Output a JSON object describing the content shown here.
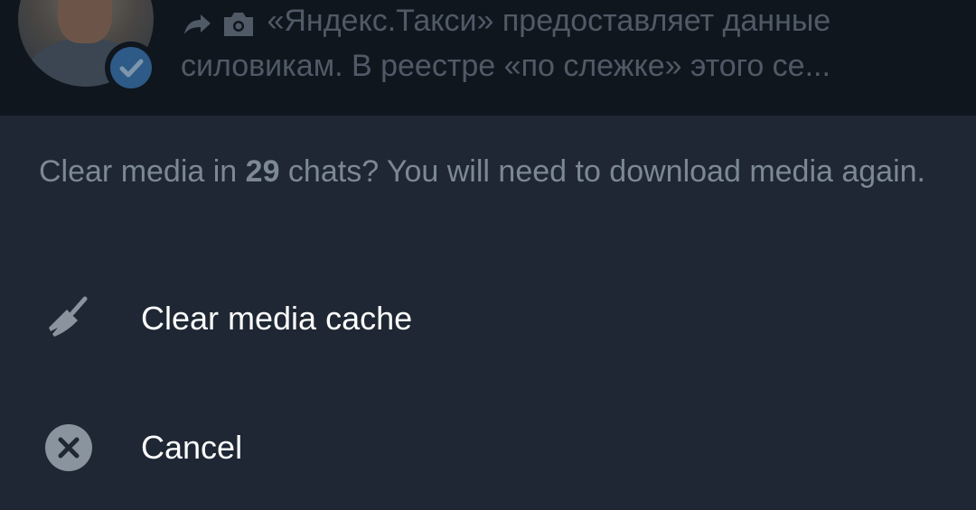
{
  "background_chat": {
    "preview_line1": "«Яндекс.Такси» предоставляет данные",
    "preview_line2": "силовикам. В реестре «по слежке» этого се...",
    "icons": [
      "forward-arrow-icon",
      "camera-icon",
      "verified-check-icon"
    ]
  },
  "dialog": {
    "message_prefix": "Clear media in ",
    "message_count": "29",
    "message_suffix": " chats? You will need to download media again.",
    "options": [
      {
        "label": "Clear media cache",
        "icon": "broom-icon"
      },
      {
        "label": "Cancel",
        "icon": "close-circle-icon"
      }
    ]
  },
  "colors": {
    "sheet_background": "#1e2733",
    "dimmed_background": "#10161e",
    "message_text": "#7c8894",
    "option_text": "#ffffff",
    "icon_gray": "#8a949e"
  }
}
